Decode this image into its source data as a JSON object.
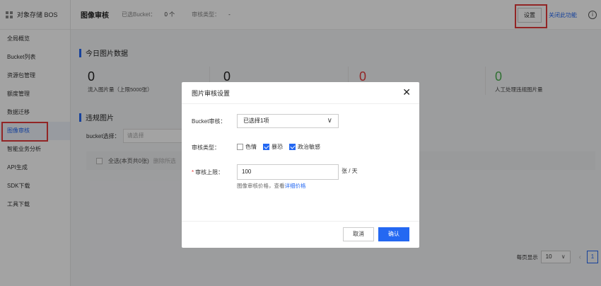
{
  "sidebar": {
    "title": "对象存储 BOS",
    "items": [
      {
        "label": "全局概览"
      },
      {
        "label": "Bucket列表"
      },
      {
        "label": "资源包管理"
      },
      {
        "label": "额度管理"
      },
      {
        "label": "数据迁移"
      },
      {
        "label": "图像审核"
      },
      {
        "label": "智能业务分析"
      },
      {
        "label": "API生成"
      },
      {
        "label": "SDK下载"
      },
      {
        "label": "工具下载"
      }
    ],
    "active_index": 5
  },
  "topbar": {
    "title": "图像审核",
    "selected_label": "已选Bucket：",
    "selected_value": "0 个",
    "type_label": "审核类型：",
    "type_value": "-",
    "settings_label": "设置",
    "disable_label": "关闭此功能",
    "info_glyph": "i"
  },
  "today": {
    "title": "今日图片数据",
    "stats": [
      {
        "value": "0",
        "label": "流入图片量（上限5000张）",
        "color": "default"
      },
      {
        "value": "0",
        "label": "",
        "color": "default"
      },
      {
        "value": "0",
        "label": "",
        "color": "red"
      },
      {
        "value": "0",
        "label": "人工处理违规图片量",
        "color": "green"
      }
    ]
  },
  "violations": {
    "title": "违规图片",
    "bucket_label": "bucket选择：",
    "bucket_placeholder": "请选择",
    "select_all": "全选(本页共0张)",
    "delete_label": "删除所选"
  },
  "pager": {
    "per_page_label": "每页显示",
    "per_page": "10",
    "prev_glyph": "‹",
    "current_page": "1"
  },
  "modal": {
    "title": "图片审核设置",
    "close_glyph": "✕",
    "bucket_label": "Bucket审核：",
    "bucket_value": "已选择1项",
    "type_label": "审核类型：",
    "types": [
      {
        "label": "色情",
        "checked": false
      },
      {
        "label": "暴恐",
        "checked": true
      },
      {
        "label": "政治敏感",
        "checked": true
      }
    ],
    "limit_required": "*",
    "limit_label": "审核上限：",
    "limit_value": "100",
    "limit_unit": "张 / 天",
    "hint_text": "图像审核价格，查看",
    "hint_link": "详细价格",
    "cancel_label": "取消",
    "ok_label": "确认"
  },
  "colors": {
    "accent": "#2468f2",
    "highlight": "#e53b3b",
    "danger": "#e53b3b",
    "success": "#4caf50"
  }
}
